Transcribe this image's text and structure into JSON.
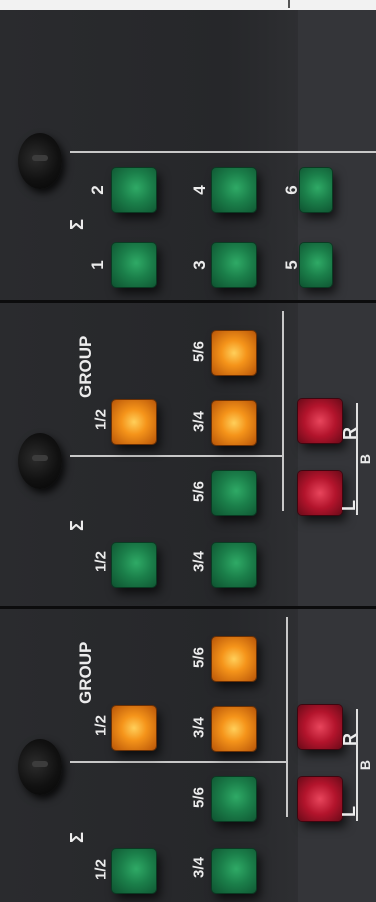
{
  "strips": [
    {
      "sigma": "Σ",
      "buttons": [
        {
          "label": "1",
          "color": "green"
        },
        {
          "label": "2",
          "color": "green"
        },
        {
          "label": "3",
          "color": "green"
        },
        {
          "label": "4",
          "color": "green"
        },
        {
          "label": "5",
          "color": "green"
        },
        {
          "label": "6",
          "color": "green"
        }
      ]
    },
    {
      "sigma": "Σ",
      "group_title": "GROUP",
      "buttons": [
        {
          "label": "1/2",
          "color": "green"
        },
        {
          "label": "3/4",
          "color": "green"
        },
        {
          "label": "5/6",
          "color": "green"
        },
        {
          "label": "1/2",
          "color": "orange"
        },
        {
          "label": "3/4",
          "color": "orange"
        },
        {
          "label": "5/6",
          "color": "orange"
        }
      ],
      "lr": {
        "l": "L",
        "r": "R",
        "b": "B"
      }
    },
    {
      "sigma": "Σ",
      "group_title": "GROUP",
      "buttons": [
        {
          "label": "1/2",
          "color": "green"
        },
        {
          "label": "3/4",
          "color": "green"
        },
        {
          "label": "5/6",
          "color": "green"
        },
        {
          "label": "1/2",
          "color": "orange"
        },
        {
          "label": "3/4",
          "color": "orange"
        },
        {
          "label": "5/6",
          "color": "orange"
        }
      ],
      "lr": {
        "l": "L",
        "r": "R",
        "b": "B"
      }
    }
  ],
  "colors": {
    "green": "#1b7f4a",
    "orange": "#f5941a",
    "red": "#b3142c",
    "panel": "#26272a"
  }
}
